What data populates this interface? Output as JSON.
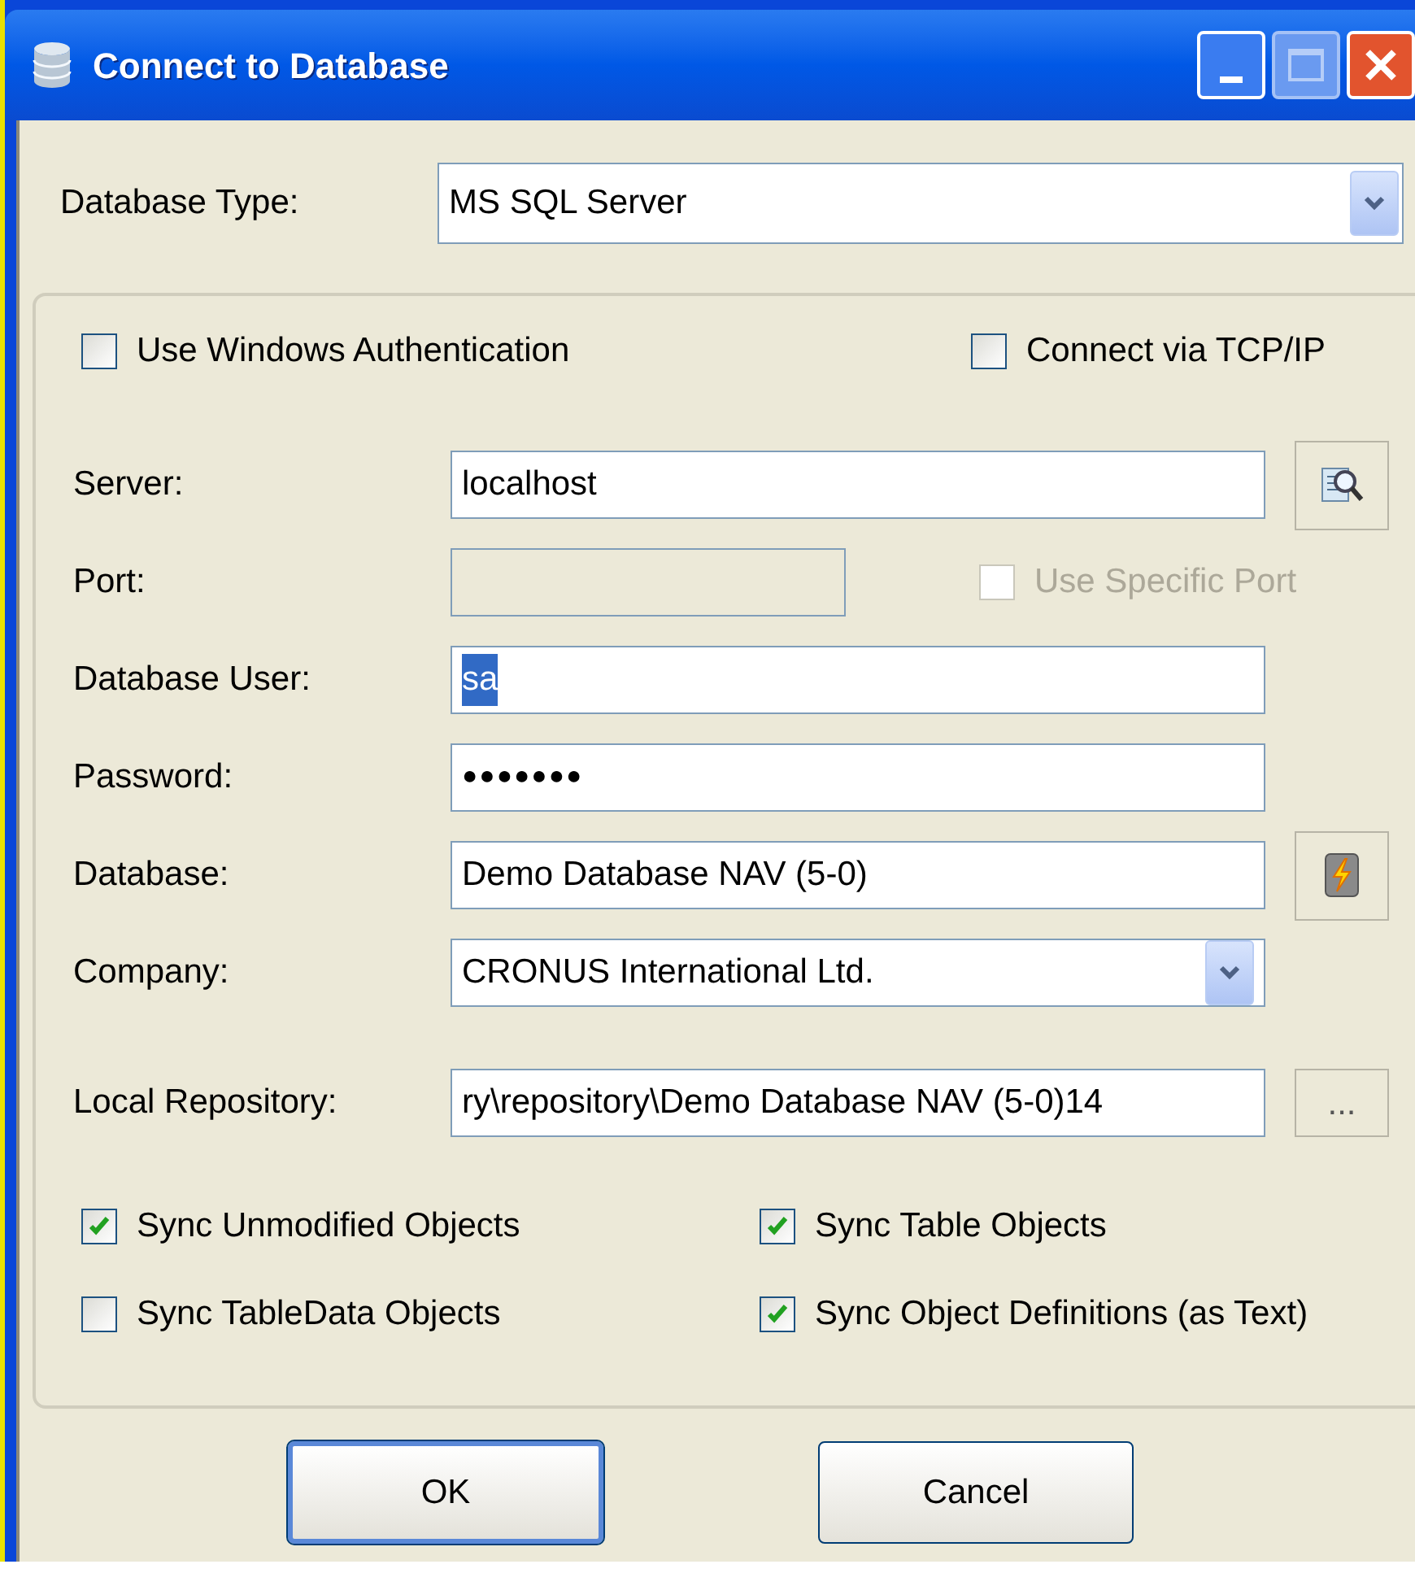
{
  "window": {
    "title": "Connect to Database"
  },
  "database_type": {
    "label": "Database Type:",
    "value": "MS SQL Server"
  },
  "options": [
    {
      "label": "Use Windows Authentication",
      "checked": false
    },
    {
      "label": "Connect via TCP/IP",
      "checked": false
    }
  ],
  "fields": [
    {
      "label": "Server:",
      "kind": "text",
      "value": "localhost",
      "disabled": false,
      "text_selected": false,
      "side": {
        "kind": "search"
      }
    },
    {
      "label": "Port:",
      "kind": "number",
      "disabled": true,
      "text_selected": false,
      "side": {
        "kind": "checkbox",
        "label": "Use Specific Port",
        "checked": false,
        "disabled": true
      }
    },
    {
      "label": "Database User:",
      "kind": "text",
      "value": "sa",
      "disabled": false,
      "text_selected": true
    },
    {
      "label": "Password:",
      "kind": "password",
      "value": "●●●●●●●",
      "disabled": false,
      "text_selected": false
    },
    {
      "label": "Database:",
      "kind": "text",
      "value": "Demo Database NAV (5-0)",
      "disabled": false,
      "text_selected": false,
      "side": {
        "kind": "lightning"
      }
    },
    {
      "label": "Company:",
      "kind": "combo",
      "value": "CRONUS International Ltd.",
      "disabled": false,
      "text_selected": false
    },
    {
      "label": "Local Repository:",
      "kind": "text",
      "value": "ry\\repository\\Demo Database NAV (5-0)14",
      "disabled": false,
      "text_selected": false,
      "side": {
        "kind": "text",
        "label": "..."
      }
    }
  ],
  "sync_options": [
    {
      "label": "Sync Unmodified Objects",
      "checked": true
    },
    {
      "label": "Sync Table Objects",
      "checked": true
    },
    {
      "label": "Sync TableData Objects",
      "checked": false
    },
    {
      "label": "Sync Object Definitions (as Text)",
      "checked": true
    }
  ],
  "buttons": [
    {
      "label": "OK",
      "default": true
    },
    {
      "label": "Cancel",
      "default": false
    }
  ]
}
